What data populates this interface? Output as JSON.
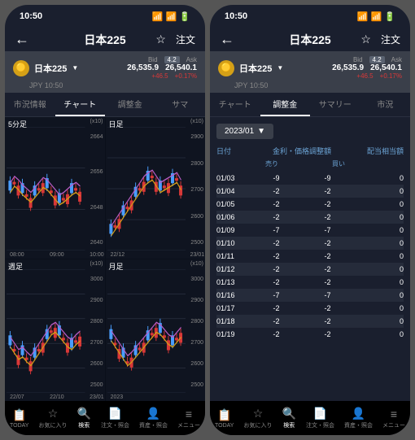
{
  "status": {
    "time": "10:50"
  },
  "header": {
    "title": "日本225",
    "order": "注文"
  },
  "info": {
    "symbol": "日本225",
    "sub": "JPY 10:50",
    "bidLbl": "Bid",
    "askLbl": "Ask",
    "spread": "4.2",
    "bid": "26,535.9",
    "ask": "26,540.1",
    "chg1": "+46.5",
    "chg2": "+0.17%"
  },
  "tabs1": [
    "市況情報",
    "チャート",
    "調整金",
    "サマ"
  ],
  "tabs2": [
    "チャート",
    "調整金",
    "サマリー",
    "市況"
  ],
  "dateSelect": "2023/01",
  "adjHdr": {
    "date": "日付",
    "col2": "金利・価格調整額",
    "col3": "配当相当額",
    "sell": "売り",
    "buy": "買い"
  },
  "adjRows": [
    {
      "d": "01/03",
      "s": "-9",
      "b": "-9",
      "v": "0"
    },
    {
      "d": "01/04",
      "s": "-2",
      "b": "-2",
      "v": "0"
    },
    {
      "d": "01/05",
      "s": "-2",
      "b": "-2",
      "v": "0"
    },
    {
      "d": "01/06",
      "s": "-2",
      "b": "-2",
      "v": "0"
    },
    {
      "d": "01/09",
      "s": "-7",
      "b": "-7",
      "v": "0"
    },
    {
      "d": "01/10",
      "s": "-2",
      "b": "-2",
      "v": "0"
    },
    {
      "d": "01/11",
      "s": "-2",
      "b": "-2",
      "v": "0"
    },
    {
      "d": "01/12",
      "s": "-2",
      "b": "-2",
      "v": "0"
    },
    {
      "d": "01/13",
      "s": "-2",
      "b": "-2",
      "v": "0"
    },
    {
      "d": "01/16",
      "s": "-7",
      "b": "-7",
      "v": "0"
    },
    {
      "d": "01/17",
      "s": "-2",
      "b": "-2",
      "v": "0"
    },
    {
      "d": "01/18",
      "s": "-2",
      "b": "-2",
      "v": "0"
    },
    {
      "d": "01/19",
      "s": "-2",
      "b": "-2",
      "v": "0"
    }
  ],
  "bottom": [
    {
      "l": "TODAY",
      "i": "📋"
    },
    {
      "l": "お気に入り",
      "i": "☆"
    },
    {
      "l": "検索",
      "i": "🔍"
    },
    {
      "l": "注文・照会",
      "i": "📄"
    },
    {
      "l": "資産・照会",
      "i": "👤"
    },
    {
      "l": "メニュー",
      "i": "≡"
    }
  ],
  "chart_data": [
    {
      "type": "candlestick",
      "title": "5分足",
      "ylim": [
        2640,
        2664
      ],
      "yticks": [
        2640,
        2648,
        2656,
        2664
      ],
      "xticks": [
        "08:00",
        "09:00",
        "10:00"
      ],
      "multiplier": "(x10)"
    },
    {
      "type": "candlestick",
      "title": "日足",
      "ylim": [
        2500,
        2900
      ],
      "yticks": [
        2500,
        2600,
        2700,
        2800,
        2900
      ],
      "xticks": [
        "22/12",
        "23/01"
      ],
      "multiplier": "(x10)"
    },
    {
      "type": "candlestick",
      "title": "週足",
      "ylim": [
        2500,
        3000
      ],
      "yticks": [
        2500,
        2600,
        2700,
        2800,
        2900,
        3000
      ],
      "xticks": [
        "22/07",
        "22/10",
        "23/01"
      ],
      "multiplier": "(x10)"
    },
    {
      "type": "candlestick",
      "title": "月足",
      "ylim": [
        2500,
        3000
      ],
      "yticks": [
        2500,
        2600,
        2700,
        2800,
        2900,
        3000
      ],
      "xticks": [
        "2023"
      ],
      "multiplier": "(x10)"
    }
  ]
}
